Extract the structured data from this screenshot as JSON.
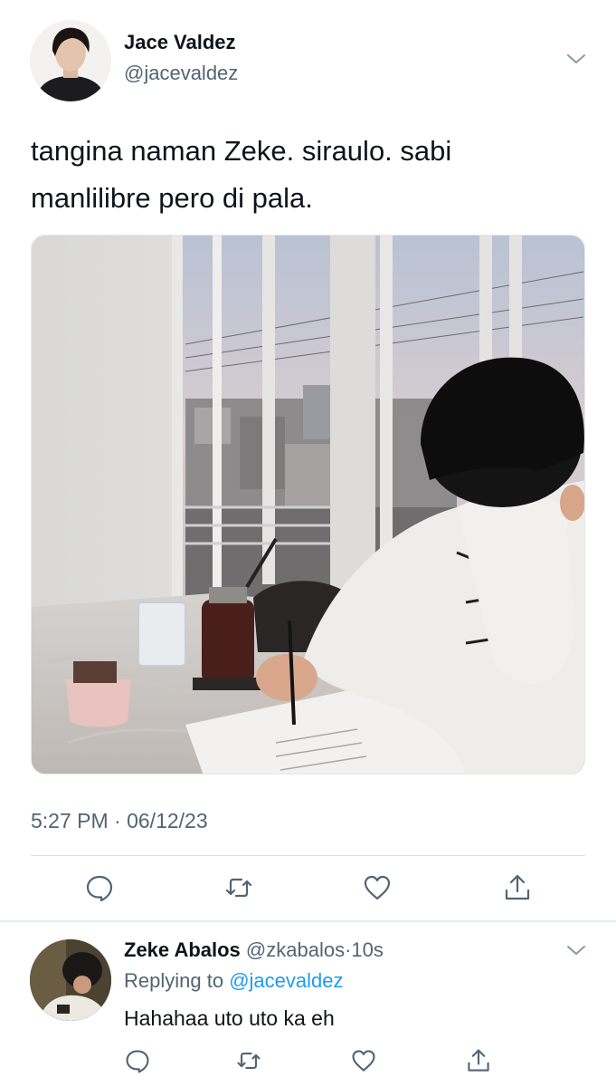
{
  "tweet": {
    "author_name": "Jace Valdez",
    "author_handle": "@jacevaldez",
    "text_line1": "tangina naman Zeke. siraulo. sabi",
    "text_line2": "manlilibre pero di pala.",
    "timestamp": "5:27 PM · 06/12/23",
    "actions": {
      "reply_icon": "speech-bubble-icon",
      "retweet_icon": "retweet-arrows-icon",
      "like_icon": "heart-icon",
      "share_icon": "share-upload-icon"
    },
    "menu_icon": "chevron-down-icon"
  },
  "reply": {
    "author_name": "Zeke Abalos",
    "author_handle": "@zkabalos",
    "separator": "·",
    "time": "10s",
    "replying_to_label": "Replying to",
    "replying_to_handle": "@jacevaldez",
    "text": "Hahahaa uto uto ka eh"
  },
  "colors": {
    "text_primary": "#0f1419",
    "text_secondary": "#536471",
    "link_blue": "#1d9bf0",
    "icon_gray": "#536471",
    "divider": "#d9dee2"
  }
}
